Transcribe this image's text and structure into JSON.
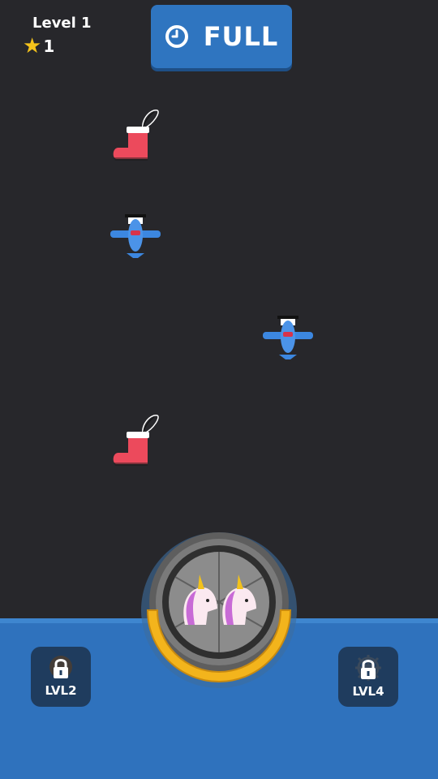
{
  "hud": {
    "level_label": "Level 1",
    "star_count": "1",
    "star_icon": "star-icon",
    "full_button_label": "FULL",
    "clock_icon": "clock-icon"
  },
  "items": [
    {
      "type": "stocking",
      "icon": "stocking-icon"
    },
    {
      "type": "airplane",
      "icon": "airplane-icon"
    },
    {
      "type": "airplane",
      "icon": "airplane-icon"
    },
    {
      "type": "stocking",
      "icon": "stocking-icon"
    }
  ],
  "spinner": {
    "contents": [
      "unicorn-icon",
      "unicorn-icon"
    ],
    "fill_fraction": 0.5
  },
  "locked_slots": [
    {
      "label": "LVL2",
      "icon": "lock-icon"
    },
    {
      "label": "LVL4",
      "icon": "lock-icon"
    }
  ],
  "colors": {
    "background": "#27272b",
    "panel": "#2f72bd",
    "button": "#2f75c0",
    "star": "#f5c31b",
    "ring": "#f3b41c"
  }
}
